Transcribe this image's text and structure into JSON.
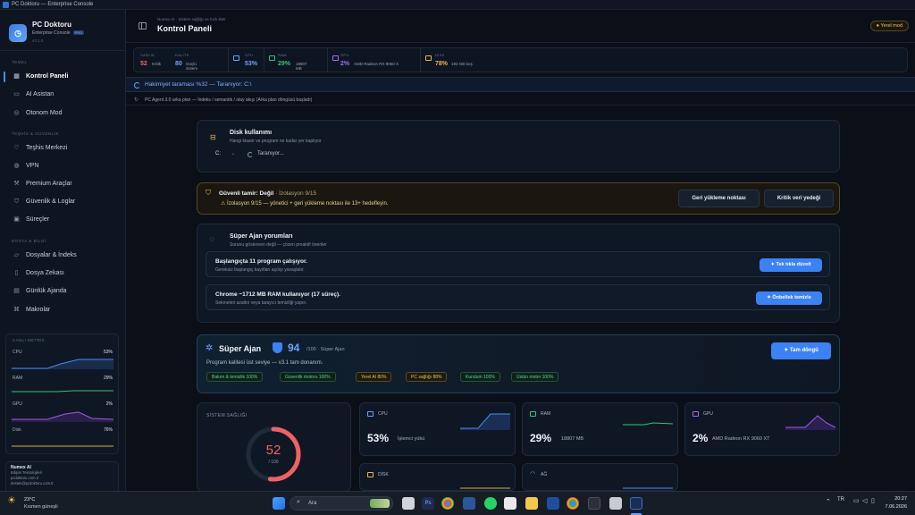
{
  "window": {
    "title": "PC Doktoru — Enterprise Console"
  },
  "brand": {
    "name": "PC Doktoru",
    "subtitle": "Enterprise Console",
    "badge": "PRO",
    "version": "v3.1.0"
  },
  "sidebar": {
    "sections": [
      {
        "label": "TEMEL"
      },
      {
        "label": "TEŞHİS & GÜVENLİK"
      },
      {
        "label": "DOSYA & BİLGİ"
      }
    ],
    "items": [
      {
        "label": "Kontrol Paneli",
        "icon": "grid-icon",
        "active": true
      },
      {
        "label": "AI Asistan",
        "icon": "chat-icon"
      },
      {
        "label": "Otonom Mod",
        "icon": "bolt-icon"
      },
      {
        "label": "Teşhis Merkezi",
        "icon": "stethoscope-icon"
      },
      {
        "label": "VPN",
        "icon": "globe-icon"
      },
      {
        "label": "Premium Araçlar",
        "icon": "wrench-icon"
      },
      {
        "label": "Güvenlik & Loglar",
        "icon": "shield-icon"
      },
      {
        "label": "Süreçler",
        "icon": "process-icon"
      },
      {
        "label": "Dosyalar & İndeks",
        "icon": "folder-icon"
      },
      {
        "label": "Dosya Zekası",
        "icon": "file-icon"
      },
      {
        "label": "Günlük Ajanda",
        "icon": "calendar-icon"
      },
      {
        "label": "Makrolar",
        "icon": "macro-icon"
      }
    ],
    "live_metrics": {
      "title": "CANLI METRİK",
      "cpu": {
        "label": "CPU",
        "value": "53%",
        "fill": 0.53,
        "color": "#4b8df0"
      },
      "ram": {
        "label": "RAM",
        "value": "29%",
        "fill": 0.29,
        "color": "#34c37a"
      },
      "gpu": {
        "label": "GPU",
        "value": "2%",
        "fill": 0.02,
        "color": "#9b5ef0"
      },
      "disk": {
        "label": "Disk",
        "value": "76%",
        "fill": 0.76,
        "color": "#e2a83a"
      }
    },
    "user": {
      "name": "Numex AI",
      "company": "Bilişim Teknolojileri",
      "site": "pcdoktoru.com.tr",
      "email": "destek@pcdoktoru.com.tr"
    }
  },
  "header": {
    "breadcrumb": "Numex AI · Sistem sağlığı ve hızlı ikler",
    "title": "Kontrol Paneli",
    "mode_badge": "Yerel mod"
  },
  "stats": [
    {
      "label": "SAĞLIK",
      "value": "52",
      "sub": "Kritik",
      "color": "#f06262"
    },
    {
      "label": "KALİTE",
      "value": "80",
      "sub": "Güçlü sistem",
      "color": "#6aa2ff"
    },
    {
      "label": "CPU",
      "value": "53%",
      "sub": "",
      "color": "#6aa2ff"
    },
    {
      "label": "RAM",
      "value": "29%",
      "sub": "18807 MB",
      "color": "#34c37a"
    },
    {
      "label": "GPU",
      "value": "2%",
      "sub": "AMD Radeon RX 9060 X",
      "color": "#a46cf5"
    },
    {
      "label": "DİSK",
      "value": "78%",
      "sub": "193 GB boş",
      "color": "#f0b34a"
    }
  ],
  "scan": {
    "text": "Hakimiyet taraması %32 — Taranıyor: C:\\"
  },
  "agent_line": {
    "text": "PC Agent 3.0 arka plan — İndeks / semantik / olay akışı (Arka plan döngüsü başladı)"
  },
  "disk_card": {
    "title": "Disk kullanımı",
    "subtitle": "Hangi klasör ve program ne kadar yer kaplıyor",
    "drive": "C:",
    "status": "Taranıyor..."
  },
  "repair_card": {
    "title": "Güvenli tamir: Değil",
    "title_sub": " · İzolasyon 9/15",
    "detail": "İzolasyon 9/15 — yönetici + geri yükleme noktası ile 13+ hedefleyin.",
    "btn_restore": "Geri yükleme noktası",
    "btn_backup": "Kritik veri yedeği"
  },
  "super_comments": {
    "title": "Süper Ajan yorumları",
    "subtitle": "Sorunu göstereen değil — çözen proaktif öneriler",
    "items": [
      {
        "title": "Başlangıçta 11 program çalışıyor.",
        "desc": "Gereksiz başlangıç kayıtları açılışı yavaşlatır.",
        "action": "Tek tıkla düzelt"
      },
      {
        "title": "Chrome ~1712 MB RAM kullanıyor (17 süreç).",
        "desc": "Sekmeleri azaltın veya tarayıcı temizliği yapın.",
        "action": "Önbellek temizle"
      }
    ]
  },
  "super_agent": {
    "title": "Süper Ajan",
    "score": "94",
    "score_suffix": "/100 · Süper Ajan",
    "desc": "Program kalitesi üst seviye — v3.1 tam donanım.",
    "button": "Tam döngü",
    "pills": [
      "Bakım & temizlik 100%",
      "Güvenlik motoru 100%",
      "Yerel AI 80%",
      "PC sağlığı 88%",
      "Kurulum 100%",
      "Üstün motor 100%"
    ]
  },
  "health": {
    "label": "SİSTEM SAĞLIĞI",
    "value": "52",
    "max": "/ 100",
    "fraction": 0.52
  },
  "metric_cards": [
    {
      "label": "CPU",
      "value": "53%",
      "unit": "İşlemci yükü",
      "color": "#4b8df0"
    },
    {
      "label": "RAM",
      "value": "29%",
      "unit": "18807 MB",
      "color": "#34c37a"
    },
    {
      "label": "GPU",
      "value": "2%",
      "unit": "AMD Radeon RX 9060 XT",
      "color": "#9b5ef0"
    },
    {
      "label": "DİSK",
      "value": "",
      "unit": "",
      "color": "#e2a83a"
    },
    {
      "label": "AĞ",
      "value": "",
      "unit": "",
      "color": "#4b8df0"
    }
  ],
  "taskbar": {
    "weather_temp": "23°C",
    "weather_desc": "Kısmen güneşli",
    "search_placeholder": "Ara",
    "lang": "TR",
    "time": "20:27",
    "date": "7.06.2026"
  },
  "colors": {
    "accent": "#3b82f6",
    "critical": "#f06262",
    "warning": "#f2c25a",
    "success": "#34c37a"
  }
}
